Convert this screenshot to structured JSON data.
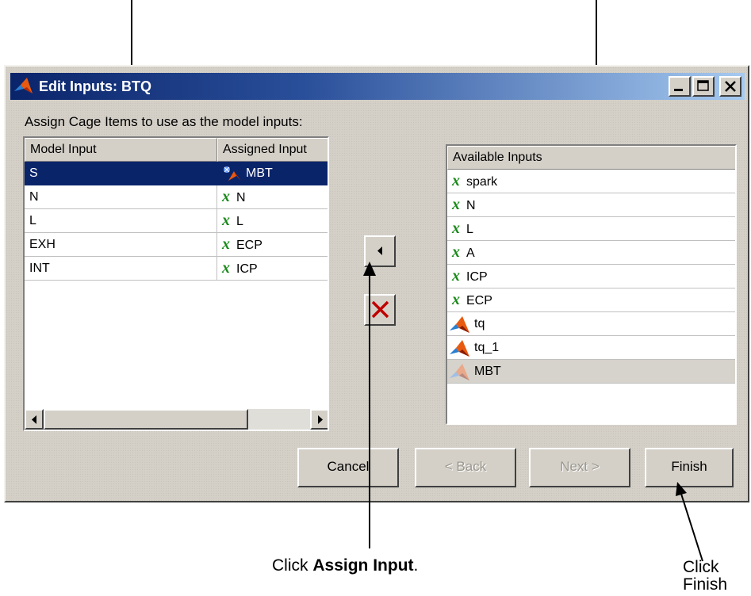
{
  "window": {
    "title": "Edit Inputs: BTQ",
    "prompt": "Assign Cage Items to use as the model inputs:"
  },
  "model_table": {
    "headers": [
      "Model Input",
      "Assigned Input"
    ],
    "rows": [
      {
        "model": "S",
        "assigned": "MBT",
        "icon": "mbt-function-icon",
        "selected": true
      },
      {
        "model": "N",
        "assigned": "N",
        "icon": "variable-x-icon"
      },
      {
        "model": "L",
        "assigned": "L",
        "icon": "variable-x-icon"
      },
      {
        "model": "EXH",
        "assigned": "ECP",
        "icon": "variable-x-icon"
      },
      {
        "model": "INT",
        "assigned": "ICP",
        "icon": "variable-x-icon"
      }
    ]
  },
  "available_list": {
    "header": "Available Inputs",
    "items": [
      {
        "label": "spark",
        "icon": "variable-x-icon"
      },
      {
        "label": "N",
        "icon": "variable-x-icon"
      },
      {
        "label": "L",
        "icon": "variable-x-icon"
      },
      {
        "label": "A",
        "icon": "variable-x-icon"
      },
      {
        "label": "ICP",
        "icon": "variable-x-icon"
      },
      {
        "label": "ECP",
        "icon": "variable-x-icon"
      },
      {
        "label": "tq",
        "icon": "model-icon"
      },
      {
        "label": "tq_1",
        "icon": "model-icon"
      },
      {
        "label": "MBT",
        "icon": "model-faded-icon",
        "highlighted": true
      }
    ]
  },
  "buttons": {
    "cancel": "Cancel",
    "back": "< Back",
    "next": "Next >",
    "finish": "Finish"
  },
  "callouts": {
    "assign_prefix": "Click ",
    "assign_bold": "Assign Input",
    "assign_suffix": ".",
    "finish_line1": "Click",
    "finish_line2": "Finish"
  },
  "colors": {
    "selection": "#0a246a",
    "variable_x": "#1a8a1a",
    "remove_x": "#c00000",
    "dialog_face": "#d4d0c8"
  }
}
